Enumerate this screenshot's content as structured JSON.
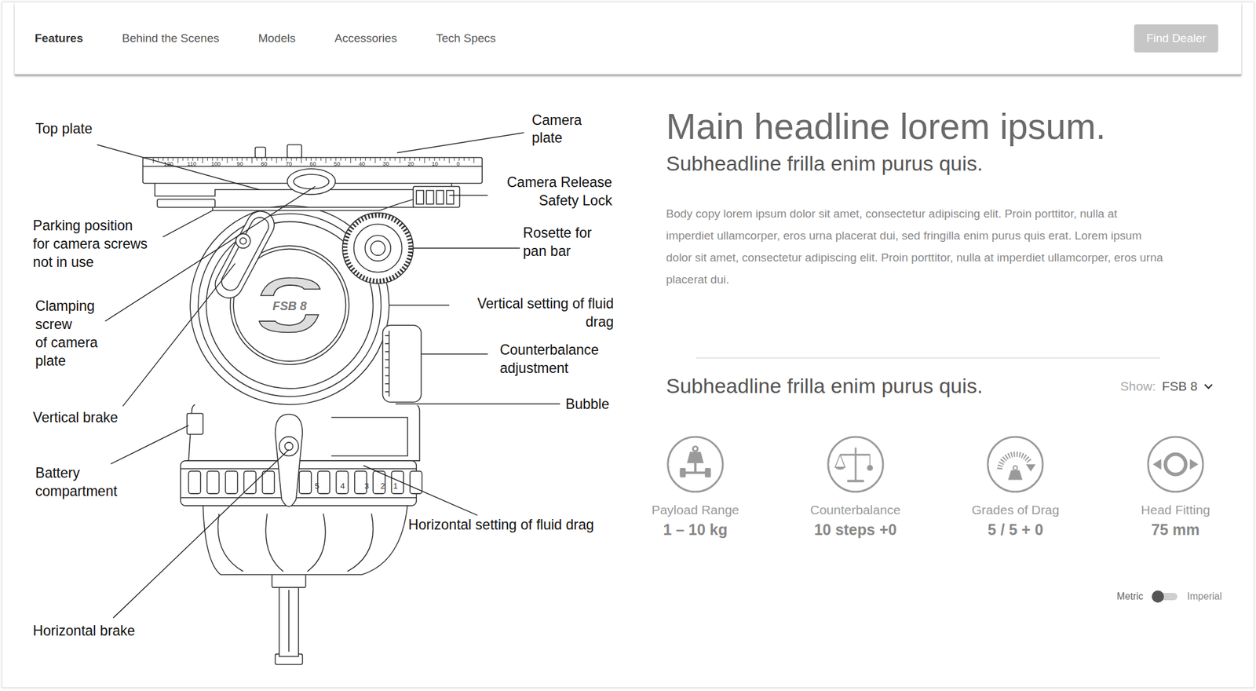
{
  "nav": {
    "tabs": [
      {
        "label": "Features",
        "selected": true
      },
      {
        "label": "Behind the Scenes",
        "selected": false
      },
      {
        "label": "Models",
        "selected": false
      },
      {
        "label": "Accessories",
        "selected": false
      },
      {
        "label": "Tech Specs",
        "selected": false
      }
    ],
    "button": "Find Dealer"
  },
  "diagram": {
    "model_badge": "FSB 8",
    "scale_numbers": [
      "120",
      "110",
      "100",
      "90",
      "80",
      "70",
      "60",
      "50",
      "40",
      "30",
      "20",
      "10",
      "0"
    ],
    "drag_numbers": [
      "5",
      "4",
      "3",
      "2",
      "1"
    ],
    "labels": [
      {
        "lines": [
          "Top plate"
        ]
      },
      {
        "lines": [
          "Camera",
          "plate"
        ]
      },
      {
        "lines": [
          "Camera Release",
          "Safety Lock"
        ]
      },
      {
        "lines": [
          "Parking position",
          "for camera screws",
          "not in use"
        ]
      },
      {
        "lines": [
          "Rosette for",
          "pan bar"
        ]
      },
      {
        "lines": [
          "Clamping",
          "screw",
          "of camera",
          "plate"
        ]
      },
      {
        "lines": [
          "Vertical setting of fluid",
          "drag"
        ]
      },
      {
        "lines": [
          "Counterbalance",
          "adjustment"
        ]
      },
      {
        "lines": [
          "Vertical brake"
        ]
      },
      {
        "lines": [
          "Bubble"
        ]
      },
      {
        "lines": [
          "Battery",
          "compartment"
        ]
      },
      {
        "lines": [
          "Horizontal setting of fluid drag"
        ]
      },
      {
        "lines": [
          "Horizontal brake"
        ]
      }
    ]
  },
  "content": {
    "headline": "Main headline lorem ipsum.",
    "subheadline": "Subheadline frilla enim purus quis.",
    "body": "Body copy lorem ipsum dolor sit amet, consectetur adipiscing elit. Proin porttitor, nulla at imperdiet ullamcorper, eros urna placerat dui, sed fringilla enim purus quis erat. Lorem ipsum dolor sit amet, consectetur adipiscing elit. Proin porttitor, nulla at imperdiet ullamcorper, eros urna placerat dui.",
    "section_title": "Subheadline frilla enim purus quis.",
    "show": {
      "label": "Show:",
      "value": "FSB 8"
    }
  },
  "specs": [
    {
      "label": "Payload Range",
      "value": "1 – 10 kg"
    },
    {
      "label": "Counterbalance",
      "value": "10 steps +0"
    },
    {
      "label": "Grades of Drag",
      "value": "5 / 5 + 0"
    },
    {
      "label": "Head Fitting",
      "value": "75 mm"
    }
  ],
  "units": [
    {
      "label": "Metric",
      "selected": true
    },
    {
      "label": "Imperial",
      "selected": false
    }
  ]
}
